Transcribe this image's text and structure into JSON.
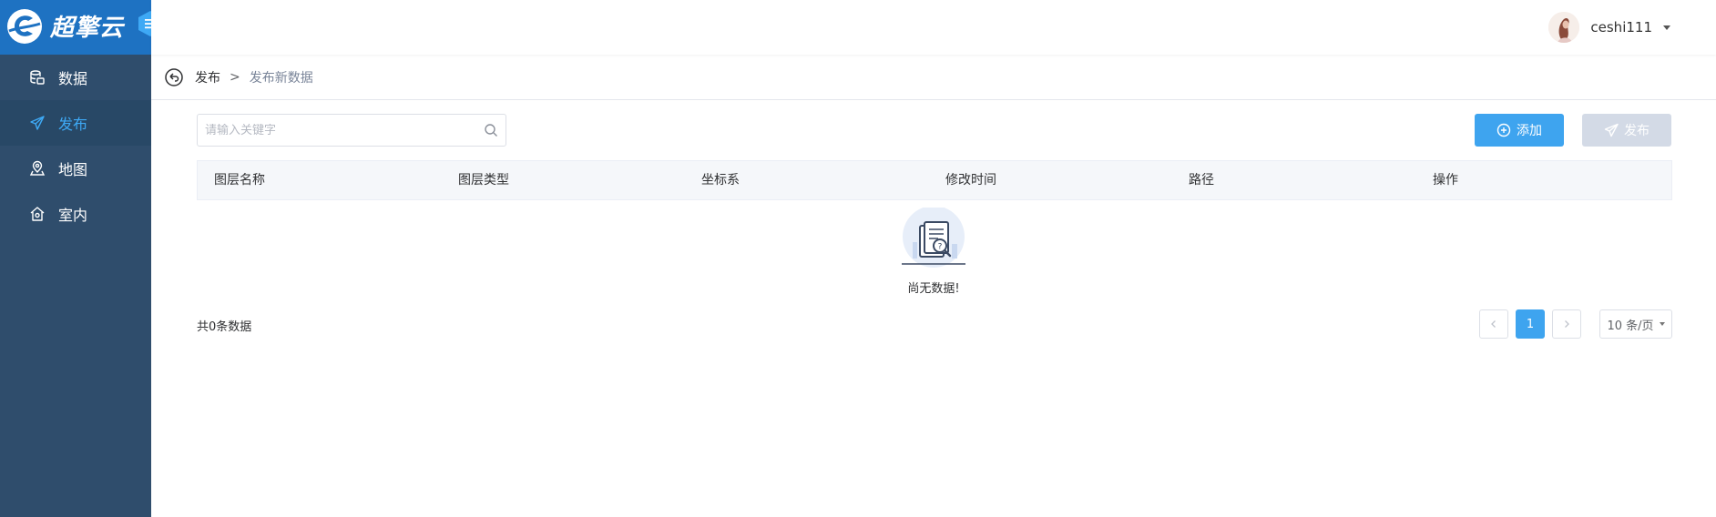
{
  "brand": {
    "name": "超擎云",
    "color": "#1e72c2"
  },
  "sidebar": {
    "items": [
      {
        "label": "数据",
        "icon": "database-icon",
        "active": false
      },
      {
        "label": "发布",
        "icon": "send-icon",
        "active": true
      },
      {
        "label": "地图",
        "icon": "map-pin-icon",
        "active": false
      },
      {
        "label": "室内",
        "icon": "indoor-icon",
        "active": false
      }
    ]
  },
  "header": {
    "username": "ceshi111"
  },
  "breadcrumb": {
    "parent": "发布",
    "separator": ">",
    "current": "发布新数据"
  },
  "toolbar": {
    "search_placeholder": "请输入关键字",
    "add_label": "添加",
    "publish_label": "发布"
  },
  "table": {
    "columns": [
      "图层名称",
      "图层类型",
      "坐标系",
      "修改时间",
      "路径",
      "操作"
    ],
    "rows": [],
    "empty_text": "尚无数据!"
  },
  "footer": {
    "total_text": "共0条数据",
    "current_page": "1",
    "page_size": "10 条/页"
  },
  "colors": {
    "accent": "#3ea4ef",
    "sidebar_bg": "#2f4d6c",
    "disabled_button": "#d3dae6"
  }
}
